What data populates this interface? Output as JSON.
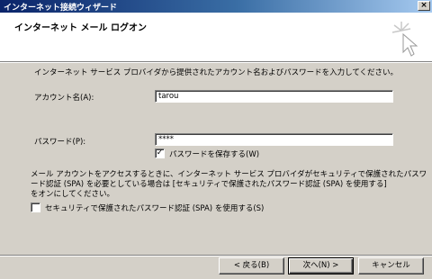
{
  "window": {
    "title": "インターネット接続ウィザード",
    "close_glyph": "×"
  },
  "header": {
    "title": "インターネット メール ログオン"
  },
  "form": {
    "instruction": "インターネット サービス プロバイダから提供されたアカウント名およびパスワードを入力してください。",
    "account_label": "アカウント名(A):",
    "account_value": "tarou",
    "password_label": "パスワード(P):",
    "password_value": "****",
    "save_password_label": "パスワードを保存する(W)",
    "save_password_checked": true,
    "spa_note_line1": "メール アカウントをアクセスするときに、インターネット サービス プロバイダがセキュリティで保護されたパスワ",
    "spa_note_line2": "ード認証 (SPA) を必要としている場合は [セキュリティで保護されたパスワード認証 (SPA) を使用する]",
    "spa_note_line3": "をオンにしてください。",
    "spa_label": "セキュリティで保護されたパスワード認証 (SPA) を使用する(S)",
    "spa_checked": false
  },
  "buttons": {
    "back": "< 戻る(B)",
    "next": "次へ(N) >",
    "cancel": "キャンセル"
  }
}
